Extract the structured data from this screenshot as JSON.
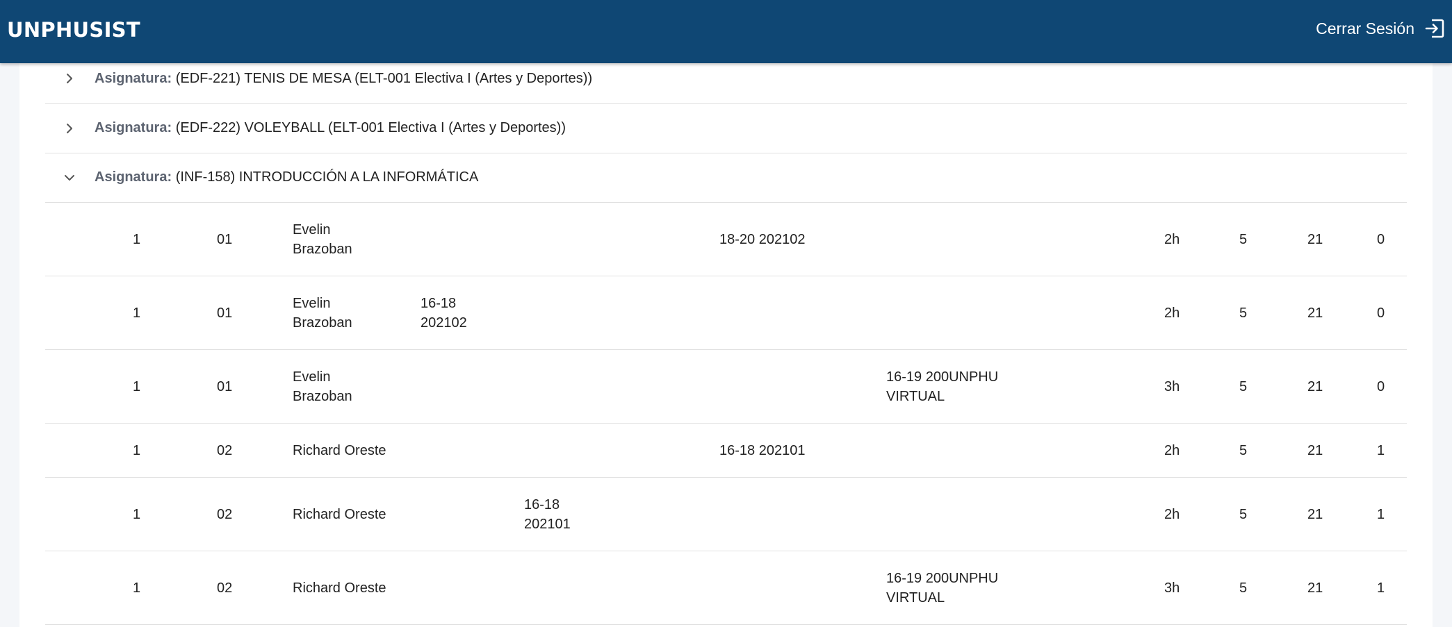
{
  "header": {
    "brand": "UNPHUSIST",
    "logout_label": "Cerrar Sesión"
  },
  "subjects": [
    {
      "label": "Asignatura:",
      "name": "(EDF-221) TENIS DE MESA (ELT-001 Electiva I (Artes y Deportes))",
      "expanded": false
    },
    {
      "label": "Asignatura:",
      "name": "(EDF-222) VOLEYBALL (ELT-001 Electiva I (Artes y Deportes))",
      "expanded": false
    },
    {
      "label": "Asignatura:",
      "name": "(INF-158) INTRODUCCIÓN A LA INFORMÁTICA",
      "expanded": true
    }
  ],
  "sections": [
    {
      "num": "1",
      "sec": "01",
      "prof": "Evelin Brazoban",
      "d1": "",
      "d2": "",
      "d3": "18-20 202102",
      "d4": "",
      "hours": "2h",
      "credits": "5",
      "capacity": "21",
      "enrolled": "0"
    },
    {
      "num": "1",
      "sec": "01",
      "prof": "Evelin Brazoban",
      "d1": "16-18 202102",
      "d2": "",
      "d3": "",
      "d4": "",
      "hours": "2h",
      "credits": "5",
      "capacity": "21",
      "enrolled": "0"
    },
    {
      "num": "1",
      "sec": "01",
      "prof": "Evelin Brazoban",
      "d1": "",
      "d2": "",
      "d3": "",
      "d4": "16-19 200UNPHU VIRTUAL",
      "hours": "3h",
      "credits": "5",
      "capacity": "21",
      "enrolled": "0"
    },
    {
      "num": "1",
      "sec": "02",
      "prof": "Richard Oreste",
      "d1": "",
      "d2": "",
      "d3": "16-18 202101",
      "d4": "",
      "hours": "2h",
      "credits": "5",
      "capacity": "21",
      "enrolled": "1"
    },
    {
      "num": "1",
      "sec": "02",
      "prof": "Richard Oreste",
      "d1": "",
      "d2": "16-18 202101",
      "d3": "",
      "d4": "",
      "hours": "2h",
      "credits": "5",
      "capacity": "21",
      "enrolled": "1"
    },
    {
      "num": "1",
      "sec": "02",
      "prof": "Richard Oreste",
      "d1": "",
      "d2": "",
      "d3": "",
      "d4": "16-19 200UNPHU VIRTUAL",
      "hours": "3h",
      "credits": "5",
      "capacity": "21",
      "enrolled": "1"
    }
  ],
  "icons": {
    "collapsed": "chevron-right-icon",
    "expanded": "chevron-down-icon",
    "logout": "logout-icon"
  },
  "colors": {
    "header_bg": "#0f4774",
    "label": "#5c6370"
  }
}
